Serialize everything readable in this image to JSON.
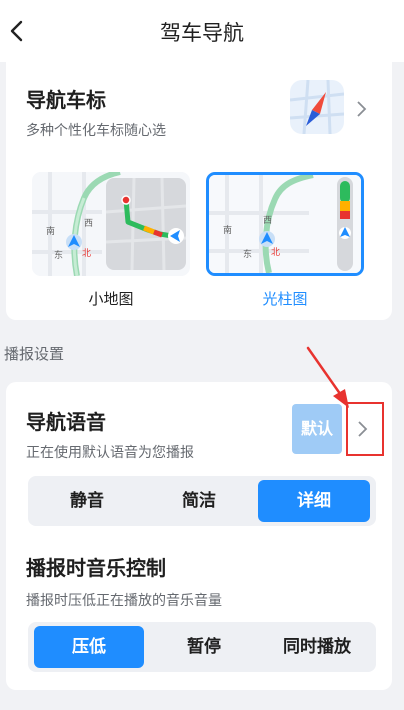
{
  "header": {
    "title": "驾车导航"
  },
  "nav_icon_card": {
    "title": "导航车标",
    "subtitle": "多种个性化车标随心选",
    "options": [
      {
        "label": "小地图",
        "selected": false
      },
      {
        "label": "光柱图",
        "selected": true
      }
    ],
    "map_labels": {
      "south": "南",
      "west": "西",
      "east": "东",
      "north": "北"
    }
  },
  "broadcast": {
    "section_label": "播报设置",
    "voice": {
      "title": "导航语音",
      "subtitle": "正在使用默认语音为您播报",
      "badge": "默认",
      "modes": [
        {
          "label": "静音",
          "active": false
        },
        {
          "label": "简洁",
          "active": false
        },
        {
          "label": "详细",
          "active": true
        }
      ]
    },
    "music": {
      "title": "播报时音乐控制",
      "subtitle": "播报时压低正在播放的音乐音量",
      "modes": [
        {
          "label": "压低",
          "active": true
        },
        {
          "label": "暂停",
          "active": false
        },
        {
          "label": "同时播放",
          "active": false
        }
      ]
    }
  },
  "colors": {
    "accent": "#1f8dff",
    "annotation": "#e8332f"
  }
}
